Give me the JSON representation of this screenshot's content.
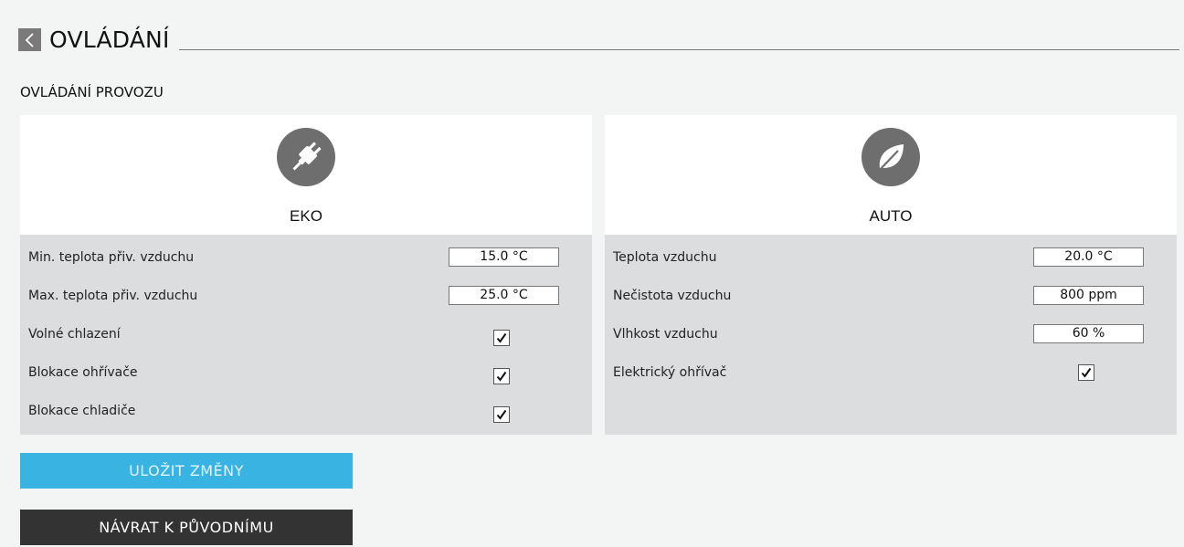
{
  "header": {
    "title": "OVLÁDÁNÍ"
  },
  "section": {
    "title": "OVLÁDÁNÍ PROVOZU"
  },
  "panels": {
    "eko": {
      "label": "EKO",
      "icon": "plug-icon",
      "rows": [
        {
          "label": "Min. teplota přiv. vzduchu",
          "value": "15.0  °C"
        },
        {
          "label": "Max. teplota přiv. vzduchu",
          "value": "25.0 °C"
        },
        {
          "label": "Volné chlazení",
          "checked": true
        },
        {
          "label": "Blokace ohřívače",
          "checked": true
        },
        {
          "label": "Blokace chladiče",
          "checked": true
        }
      ]
    },
    "auto": {
      "label": "AUTO",
      "icon": "leaf-icon",
      "rows": [
        {
          "label": "Teplota vzduchu",
          "value": "20.0  °C"
        },
        {
          "label": "Nečistota vzduchu",
          "value": "800 ppm"
        },
        {
          "label": "Vlhkost vzduchu",
          "value": "60 %"
        },
        {
          "label": "Elektrický ohřívač",
          "checked": true
        }
      ]
    }
  },
  "buttons": {
    "save": "ULOŽIT ZMĚNY",
    "revert": "NÁVRAT K PŮVODNÍMU"
  },
  "colors": {
    "accent": "#38b3e2",
    "dark_button": "#333333",
    "panel_body": "#dcdddf",
    "icon_gray": "#6e6e6e"
  }
}
